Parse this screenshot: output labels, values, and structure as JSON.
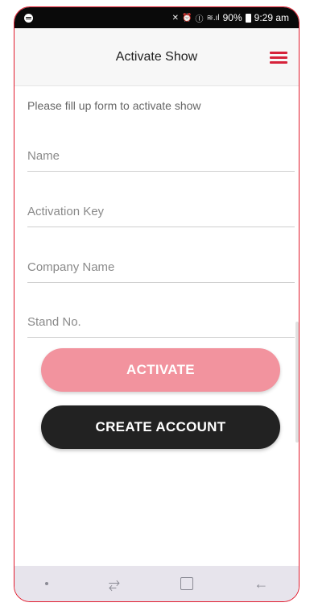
{
  "status_bar": {
    "signal_text": "90%",
    "time": "9:29 am"
  },
  "app_bar": {
    "title": "Activate Show"
  },
  "form": {
    "instruction": "Please fill up form to activate show",
    "fields": [
      {
        "placeholder": "Name",
        "value": ""
      },
      {
        "placeholder": "Activation Key",
        "value": ""
      },
      {
        "placeholder": "Company Name",
        "value": ""
      },
      {
        "placeholder": "Stand No.",
        "value": ""
      }
    ]
  },
  "buttons": {
    "activate_label": "ACTIVATE",
    "create_account_label": "CREATE ACCOUNT"
  },
  "colors": {
    "accent": "#d6223a",
    "activate_button": "#f2939e",
    "create_button": "#222222"
  }
}
